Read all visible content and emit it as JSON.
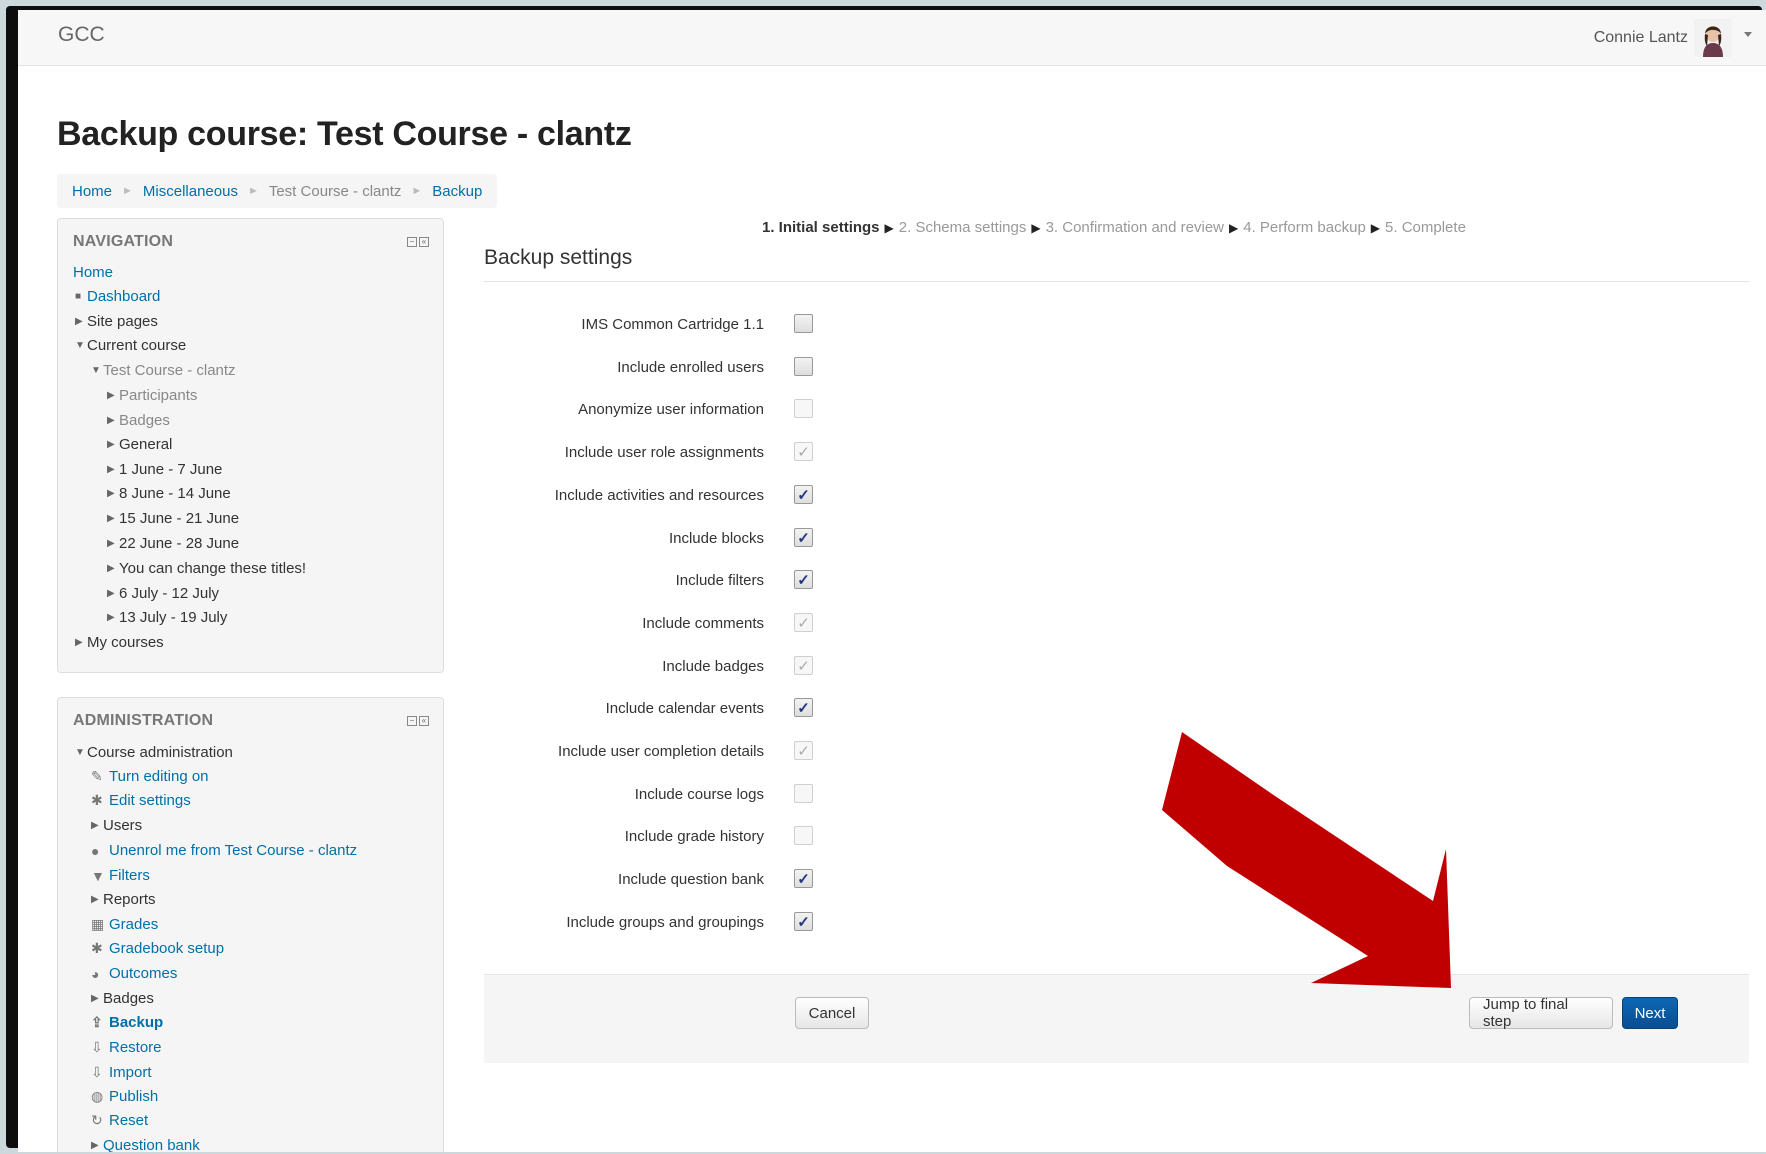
{
  "header": {
    "brand": "GCC",
    "user_name": "Connie Lantz"
  },
  "page_title": "Backup course: Test Course - clantz",
  "breadcrumb": [
    "Home",
    "Miscellaneous",
    "Test Course - clantz",
    "Backup"
  ],
  "navigation": {
    "title": "NAVIGATION",
    "items": [
      "Home",
      "Dashboard",
      "Site pages",
      "Current course",
      "Test Course - clantz",
      "Participants",
      "Badges",
      "General",
      "1 June - 7 June",
      "8 June - 14 June",
      "15 June - 21 June",
      "22 June - 28 June",
      "You can change these titles!",
      "6 July - 12 July",
      "13 July - 19 July",
      "My courses"
    ]
  },
  "administration": {
    "title": "ADMINISTRATION",
    "items": [
      "Course administration",
      "Turn editing on",
      "Edit settings",
      "Users",
      "Unenrol me from Test Course - clantz",
      "Filters",
      "Reports",
      "Grades",
      "Gradebook setup",
      "Outcomes",
      "Badges",
      "Backup",
      "Restore",
      "Import",
      "Publish",
      "Reset",
      "Question bank"
    ]
  },
  "steps": [
    "1. Initial settings",
    "2. Schema settings",
    "3. Confirmation and review",
    "4. Perform backup",
    "5. Complete"
  ],
  "section_title": "Backup settings",
  "settings": [
    {
      "label": "IMS Common Cartridge 1.1",
      "checked": false,
      "disabled": false
    },
    {
      "label": "Include enrolled users",
      "checked": false,
      "disabled": false
    },
    {
      "label": "Anonymize user information",
      "checked": false,
      "disabled": true
    },
    {
      "label": "Include user role assignments",
      "checked": true,
      "disabled": true
    },
    {
      "label": "Include activities and resources",
      "checked": true,
      "disabled": false
    },
    {
      "label": "Include blocks",
      "checked": true,
      "disabled": false
    },
    {
      "label": "Include filters",
      "checked": true,
      "disabled": false
    },
    {
      "label": "Include comments",
      "checked": true,
      "disabled": true
    },
    {
      "label": "Include badges",
      "checked": true,
      "disabled": true
    },
    {
      "label": "Include calendar events",
      "checked": true,
      "disabled": false
    },
    {
      "label": "Include user completion details",
      "checked": true,
      "disabled": true
    },
    {
      "label": "Include course logs",
      "checked": false,
      "disabled": true
    },
    {
      "label": "Include grade history",
      "checked": false,
      "disabled": true
    },
    {
      "label": "Include question bank",
      "checked": true,
      "disabled": false
    },
    {
      "label": "Include groups and groupings",
      "checked": true,
      "disabled": false
    }
  ],
  "buttons": {
    "cancel": "Cancel",
    "jump": "Jump to final step",
    "next": "Next"
  },
  "colors": {
    "link": "#0070a8",
    "primary_button": "#0a57a4",
    "annotation_arrow": "#c00000"
  }
}
